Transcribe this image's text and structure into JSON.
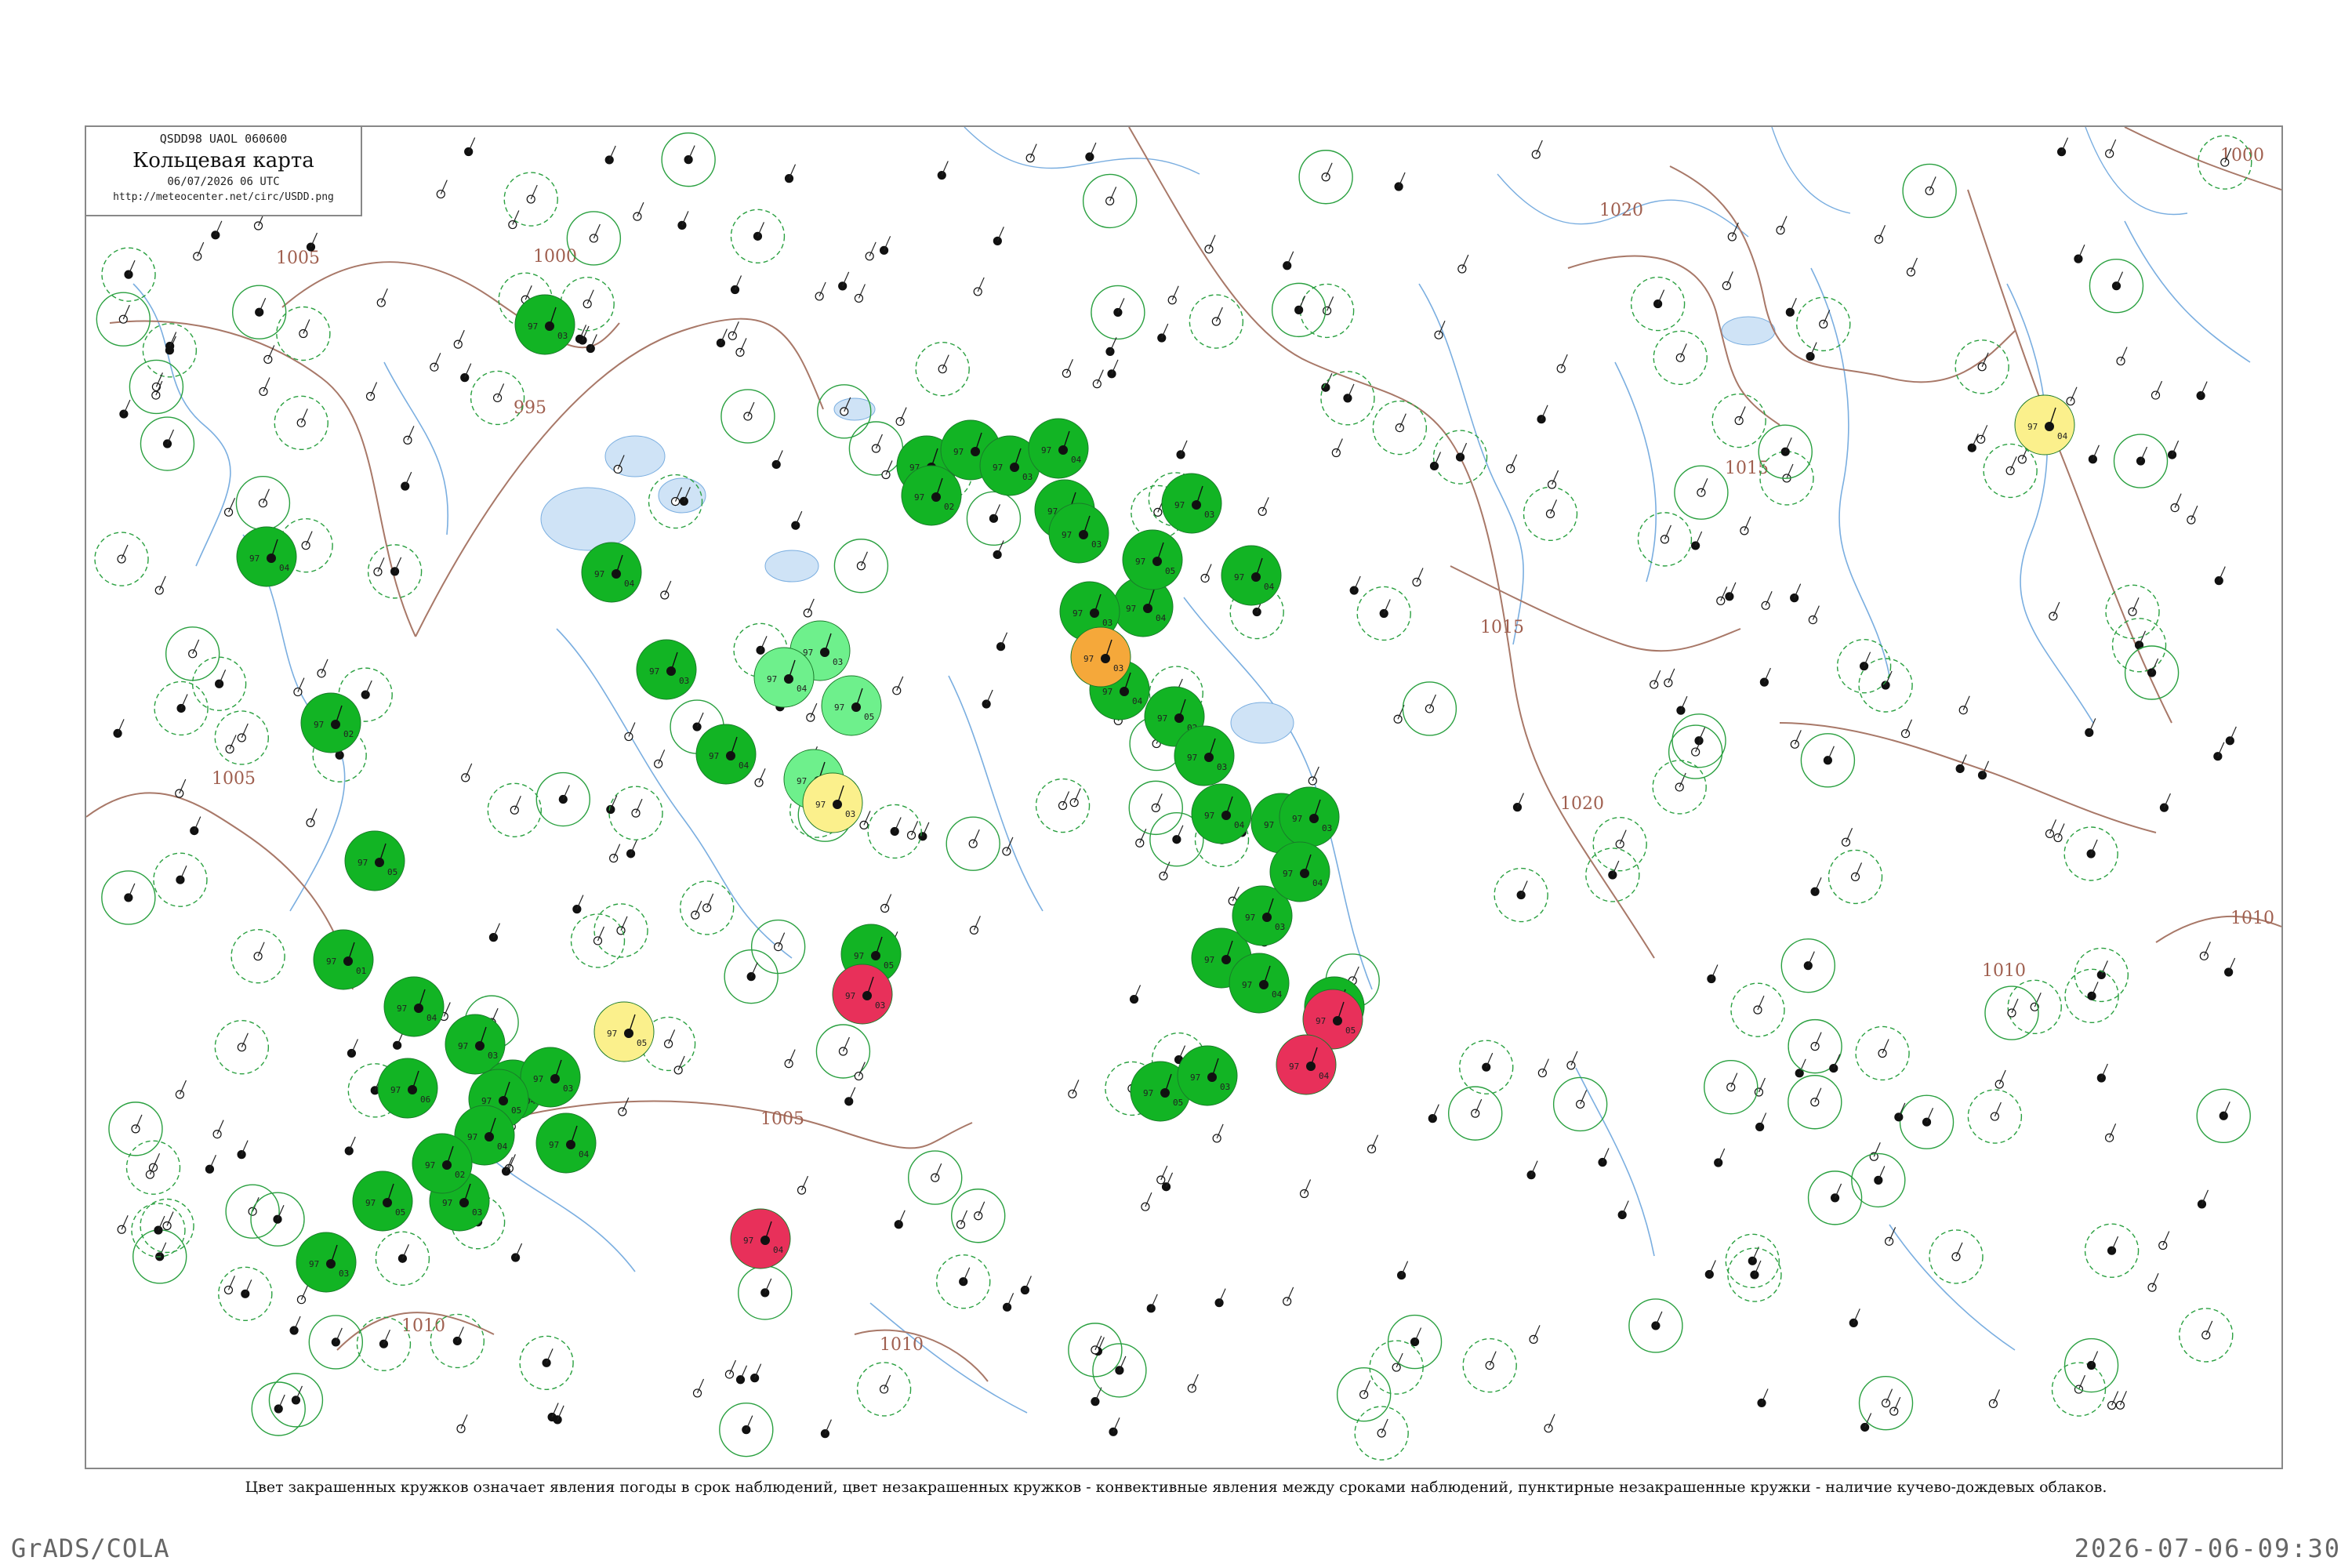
{
  "header": {
    "code": "QSDD98  UAOL  060600",
    "title": "Кольцевая карта",
    "date": "06/07/2026 06 UTC",
    "url": "http://meteocenter.net/circ/USDD.png"
  },
  "caption": "Цвет закрашенных кружков означает явления погоды в срок наблюдений, цвет незакрашенных кружков - конвективные явления между сроками наблюдений, пунктирные незакрашенные кружки - наличие кучево-дождевых облаков.",
  "footer": {
    "left": "GrADS/COLA",
    "right": "2026-07-06-09:30"
  },
  "colors": {
    "green": "#12b424",
    "light_green": "#6ef08c",
    "yellow": "#fbf08c",
    "red": "#e8305a",
    "orange": "#f5a83a",
    "isobar": "#a87868",
    "water": "#7aaee0"
  },
  "isobars": [
    {
      "label": "1000"
    },
    {
      "label": "1005"
    },
    {
      "label": "995"
    },
    {
      "label": "1005"
    },
    {
      "label": "1005"
    },
    {
      "label": "1010"
    },
    {
      "label": "1010"
    },
    {
      "label": "1020"
    },
    {
      "label": "1020"
    },
    {
      "label": "1015"
    },
    {
      "label": "1015"
    },
    {
      "label": "1010"
    },
    {
      "label": "1000"
    },
    {
      "label": "1010"
    }
  ],
  "stations": [
    {
      "name": "st-1",
      "kind": "filled",
      "color": "green",
      "t": "97",
      "p": "03"
    },
    {
      "name": "st-2",
      "kind": "filled",
      "color": "green",
      "t": "97",
      "p": "04"
    },
    {
      "name": "st-3",
      "kind": "filled",
      "color": "green",
      "t": "97",
      "p": "02"
    },
    {
      "name": "st-4",
      "kind": "filled",
      "color": "green",
      "t": "97",
      "p": "05"
    },
    {
      "name": "st-5",
      "kind": "filled",
      "color": "green",
      "t": "97",
      "p": "01"
    },
    {
      "name": "st-6",
      "kind": "filled",
      "color": "green",
      "t": "97",
      "p": "04"
    },
    {
      "name": "st-7",
      "kind": "filled",
      "color": "green",
      "t": "97",
      "p": "03"
    },
    {
      "name": "st-8",
      "kind": "filled",
      "color": "green",
      "t": "97",
      "p": "04"
    },
    {
      "name": "st-9",
      "kind": "filled",
      "color": "green",
      "t": "97",
      "p": "06"
    },
    {
      "name": "st-10",
      "kind": "filled",
      "color": "green",
      "t": "97",
      "p": "03"
    },
    {
      "name": "st-11",
      "kind": "filled",
      "color": "green",
      "t": "97",
      "p": "05"
    },
    {
      "name": "st-12",
      "kind": "filled",
      "color": "green",
      "t": "97",
      "p": "04"
    },
    {
      "name": "st-13",
      "kind": "filled",
      "color": "green",
      "t": "97",
      "p": "03"
    },
    {
      "name": "st-14",
      "kind": "filled",
      "color": "green",
      "t": "97",
      "p": "04"
    },
    {
      "name": "st-15",
      "kind": "filled",
      "color": "green",
      "t": "97",
      "p": "02"
    },
    {
      "name": "st-16",
      "kind": "filled",
      "color": "green",
      "t": "97",
      "p": "03"
    },
    {
      "name": "st-17",
      "kind": "filled",
      "color": "green",
      "t": "97",
      "p": "05"
    },
    {
      "name": "st-18",
      "kind": "filled",
      "color": "green",
      "t": "97",
      "p": "04"
    },
    {
      "name": "st-19",
      "kind": "filled",
      "color": "green",
      "t": "97",
      "p": "03"
    },
    {
      "name": "st-20",
      "kind": "filled",
      "color": "green",
      "t": "97",
      "p": "04"
    },
    {
      "name": "st-21",
      "kind": "filled",
      "color": "green",
      "t": "97",
      "p": "05"
    },
    {
      "name": "st-22",
      "kind": "filled",
      "color": "green",
      "t": "97",
      "p": "03"
    },
    {
      "name": "st-23",
      "kind": "filled",
      "color": "green",
      "t": "97",
      "p": "04"
    },
    {
      "name": "st-24",
      "kind": "filled",
      "color": "green",
      "t": "97",
      "p": "02"
    },
    {
      "name": "st-25",
      "kind": "filled",
      "color": "green",
      "t": "97",
      "p": "03"
    },
    {
      "name": "st-26",
      "kind": "filled",
      "color": "green",
      "t": "97",
      "p": "04"
    },
    {
      "name": "st-27",
      "kind": "filled",
      "color": "green",
      "t": "97",
      "p": "05"
    },
    {
      "name": "st-28",
      "kind": "filled",
      "color": "green",
      "t": "97",
      "p": "03"
    },
    {
      "name": "st-29",
      "kind": "filled",
      "color": "green",
      "t": "97",
      "p": "04"
    },
    {
      "name": "st-30",
      "kind": "filled",
      "color": "green",
      "t": "97",
      "p": "03"
    },
    {
      "name": "st-31",
      "kind": "filled",
      "color": "green",
      "t": "97",
      "p": "04"
    },
    {
      "name": "st-32",
      "kind": "filled",
      "color": "green",
      "t": "97",
      "p": "05"
    },
    {
      "name": "st-33",
      "kind": "filled",
      "color": "green",
      "t": "97",
      "p": "03"
    },
    {
      "name": "st-34",
      "kind": "filled",
      "color": "green",
      "t": "97",
      "p": "04"
    },
    {
      "name": "st-35",
      "kind": "filled",
      "color": "green",
      "t": "97",
      "p": "02"
    },
    {
      "name": "st-36",
      "kind": "filled",
      "color": "green",
      "t": "97",
      "p": "03"
    },
    {
      "name": "st-37",
      "kind": "filled",
      "color": "green",
      "t": "97",
      "p": "04"
    },
    {
      "name": "st-38",
      "kind": "filled",
      "color": "green",
      "t": "97",
      "p": "05"
    },
    {
      "name": "st-39",
      "kind": "filled",
      "color": "green",
      "t": "97",
      "p": "03"
    },
    {
      "name": "st-40",
      "kind": "filled",
      "color": "green",
      "t": "97",
      "p": "04"
    },
    {
      "name": "st-41",
      "kind": "filled",
      "color": "green",
      "t": "97",
      "p": "03"
    },
    {
      "name": "st-42",
      "kind": "filled",
      "color": "green",
      "t": "97",
      "p": "04"
    },
    {
      "name": "st-43",
      "kind": "filled",
      "color": "green",
      "t": "97",
      "p": "05"
    },
    {
      "name": "st-44",
      "kind": "filled",
      "color": "green",
      "t": "97",
      "p": "03"
    },
    {
      "name": "st-45",
      "kind": "filled",
      "color": "green",
      "t": "97",
      "p": "04"
    },
    {
      "name": "st-46",
      "kind": "filled",
      "color": "green",
      "t": "97",
      "p": "02"
    },
    {
      "name": "st-47",
      "kind": "filled",
      "color": "light_green",
      "t": "97",
      "p": "03"
    },
    {
      "name": "st-48",
      "kind": "filled",
      "color": "light_green",
      "t": "97",
      "p": "04"
    },
    {
      "name": "st-49",
      "kind": "filled",
      "color": "light_green",
      "t": "97",
      "p": "05"
    },
    {
      "name": "st-50",
      "kind": "filled",
      "color": "light_green",
      "t": "97",
      "p": "03"
    },
    {
      "name": "st-51",
      "kind": "filled",
      "color": "yellow",
      "t": "97",
      "p": "04"
    },
    {
      "name": "st-52",
      "kind": "filled",
      "color": "yellow",
      "t": "97",
      "p": "03"
    },
    {
      "name": "st-53",
      "kind": "filled",
      "color": "yellow",
      "t": "97",
      "p": "05"
    },
    {
      "name": "st-54",
      "kind": "filled",
      "color": "red",
      "t": "97",
      "p": "04"
    },
    {
      "name": "st-55",
      "kind": "filled",
      "color": "red",
      "t": "97",
      "p": "03"
    },
    {
      "name": "st-56",
      "kind": "filled",
      "color": "red",
      "t": "97",
      "p": "05"
    },
    {
      "name": "st-57",
      "kind": "filled",
      "color": "red",
      "t": "97",
      "p": "04"
    },
    {
      "name": "st-58",
      "kind": "filled",
      "color": "orange",
      "t": "97",
      "p": "03"
    }
  ]
}
